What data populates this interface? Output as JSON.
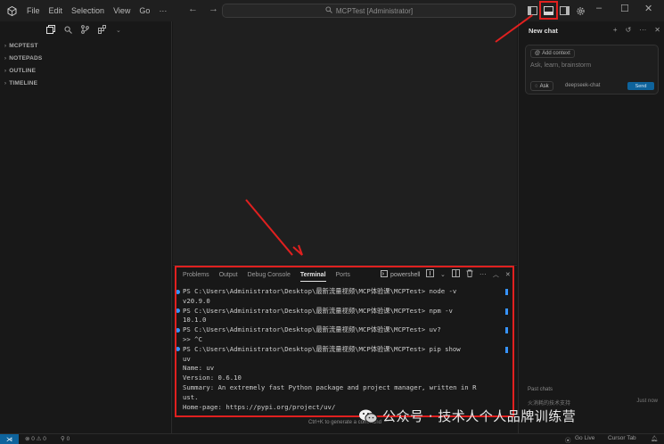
{
  "titlebar": {
    "menus": [
      "File",
      "Edit",
      "Selection",
      "View",
      "Go"
    ],
    "more": "···",
    "search_text": "MCPTest [Administrator]"
  },
  "sidebar": {
    "sections": [
      "MCPTEST",
      "NOTEPADS",
      "OUTLINE",
      "TIMELINE"
    ]
  },
  "chat": {
    "title": "New chat",
    "add_context": "Add context",
    "placeholder": "Ask, learn, brainstorm",
    "mode": "Ask",
    "model": "deepseek-chat",
    "send": "Send",
    "past_chats": "Past chats",
    "past_item": "火消耗的技术支持",
    "past_time": "Just now"
  },
  "panel": {
    "tabs": [
      "Problems",
      "Output",
      "Debug Console",
      "Terminal",
      "Ports"
    ],
    "active_tab": "Terminal",
    "shell": "powershell",
    "ctrlk_hint": "Ctrl+K to generate a command"
  },
  "terminal": {
    "lines": [
      {
        "text": "PS C:\\Users\\Administrator\\Desktop\\最新流量视频\\MCP体验课\\MCPTest> node -v",
        "dot": true
      },
      {
        "text": "v20.9.0",
        "dot": false
      },
      {
        "text": "PS C:\\Users\\Administrator\\Desktop\\最新流量视频\\MCP体验课\\MCPTest> npm -v",
        "dot": true
      },
      {
        "text": "10.1.0",
        "dot": false
      },
      {
        "text": "PS C:\\Users\\Administrator\\Desktop\\最新流量视频\\MCP体验课\\MCPTest> uv?",
        "dot": true
      },
      {
        "text": ">> ^C",
        "dot": false
      },
      {
        "text": "PS C:\\Users\\Administrator\\Desktop\\最新流量视频\\MCP体验课\\MCPTest> pip show",
        "dot": true
      },
      {
        "text": "uv",
        "dot": false
      },
      {
        "text": "Name: uv",
        "dot": false
      },
      {
        "text": "Version: 0.6.10",
        "dot": false
      },
      {
        "text": "Summary: An extremely fast Python package and project manager, written in R",
        "dot": false
      },
      {
        "text": "ust.",
        "dot": false
      },
      {
        "text": "Home-page: https://pypi.org/project/uv/",
        "dot": false
      }
    ]
  },
  "statusbar": {
    "problems": "⊗ 0 ⚠ 0",
    "ports": "⚲ 0",
    "go_live": "Go Live",
    "cursor": "Cursor Tab"
  },
  "watermark": {
    "text": "公众号 · 技术人个人品牌训练营"
  },
  "colors": {
    "accent": "#3794ff",
    "annotation": "#e0201f",
    "send": "#0e639c"
  }
}
